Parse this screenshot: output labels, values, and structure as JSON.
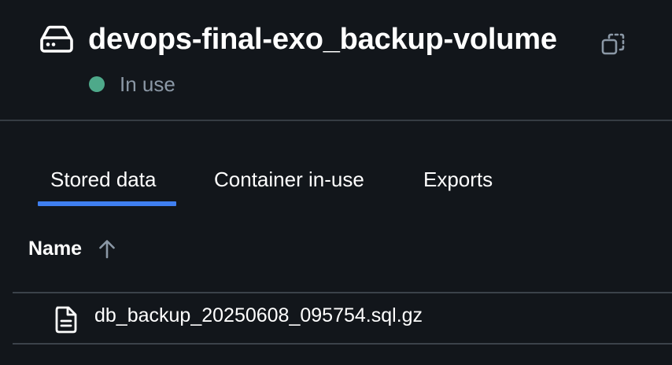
{
  "volume": {
    "name": "devops-final-exo_backup-volume",
    "icon": "hard-drive-icon",
    "status_text": "In use",
    "status_color": "#4ea98a"
  },
  "tabs": [
    {
      "label": "Stored data",
      "active": true
    },
    {
      "label": "Container in-use",
      "active": false
    },
    {
      "label": "Exports",
      "active": false
    }
  ],
  "table": {
    "columns": [
      {
        "label": "Name",
        "sort": "ascending"
      }
    ],
    "rows": [
      {
        "icon": "file-icon",
        "name": "db_backup_20250608_095754.sql.gz"
      }
    ]
  },
  "colors": {
    "background": "#12161b",
    "accent": "#3f7ff0",
    "muted_text": "#8b98a6",
    "divider": "#353c43"
  }
}
